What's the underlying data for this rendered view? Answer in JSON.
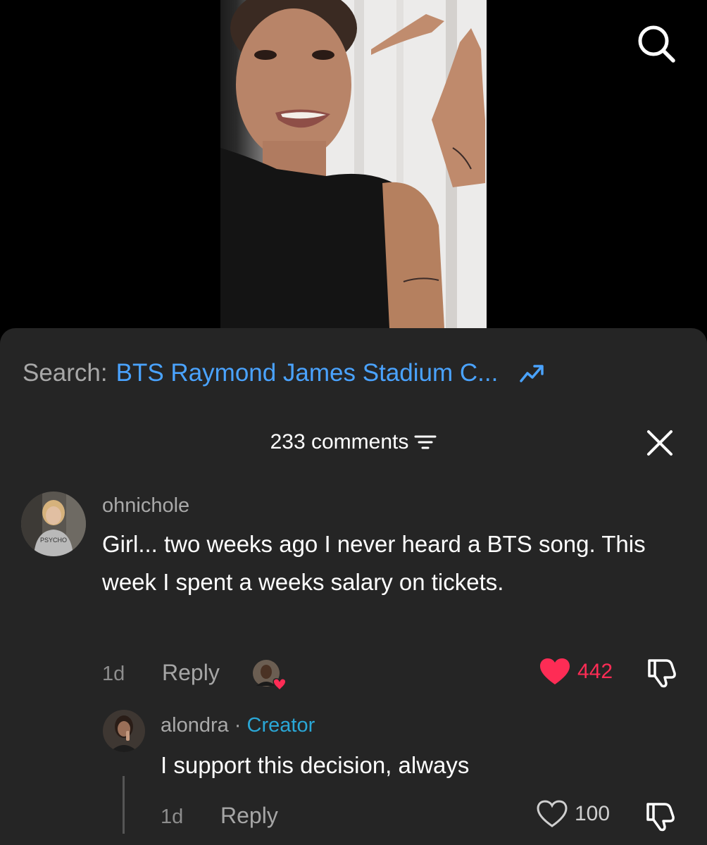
{
  "search_suggestion": {
    "label": "Search:",
    "query": "BTS Raymond James Stadium C...",
    "icon": "trending-icon"
  },
  "top_search_icon": "search-icon",
  "comments": {
    "count_label": "233 comments",
    "sort_icon": "filter-icon",
    "close_icon": "close-icon",
    "items": [
      {
        "username": "ohnichole",
        "text": "Girl... two weeks ago I never heard a BTS song. This week I spent a weeks salary on tickets.",
        "time": "1d",
        "reply_label": "Reply",
        "likes": "442",
        "liked": true,
        "creator_liked": true,
        "avatar_text": "PSYCHO"
      }
    ],
    "reply": {
      "username": "alondra",
      "separator": " · ",
      "badge": "Creator",
      "text": "I support this decision, always",
      "time": "1d",
      "reply_label": "Reply",
      "likes": "100",
      "liked": false
    }
  },
  "colors": {
    "sheet_bg": "#252525",
    "link_blue": "#4aa3ff",
    "creator_blue": "#2aa7d6",
    "like_red": "#fe2c55"
  }
}
